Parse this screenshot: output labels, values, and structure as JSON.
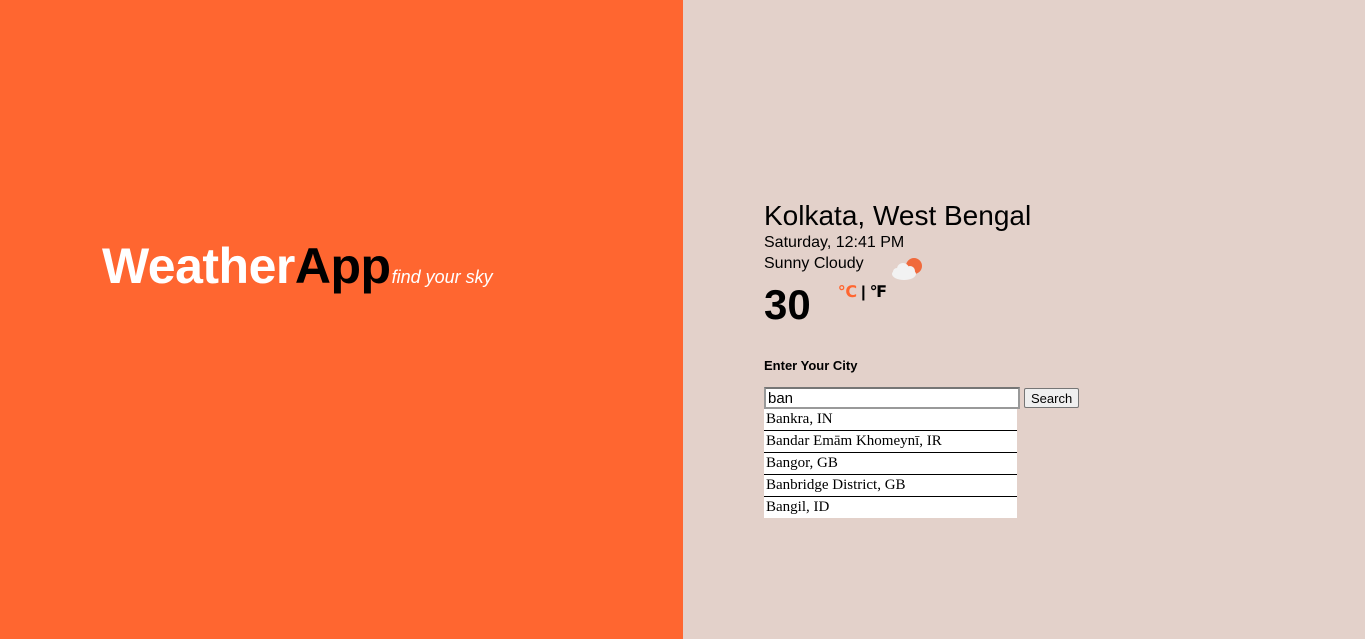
{
  "brand": {
    "name_part1": "Weather",
    "name_part2": "App",
    "tagline": "find your sky"
  },
  "weather": {
    "location": "Kolkata, West Bengal",
    "datetime": "Saturday, 12:41 PM",
    "condition": "Sunny Cloudy",
    "condition_icon": "partly-cloudy-icon",
    "temperature": "30",
    "unit_celsius": "℃",
    "unit_separator": "|",
    "unit_fahrenheit": "℉",
    "active_unit": "celsius"
  },
  "search": {
    "label": "Enter Your City",
    "value": "ban",
    "button_label": "Search",
    "suggestions": [
      "Bankra, IN",
      "Bandar Emām Khomeynī, IR",
      "Bangor, GB",
      "Banbridge District, GB",
      "Bangil, ID"
    ]
  },
  "colors": {
    "accent": "#ff6630",
    "right_background": "#e3d1ca",
    "cloud": "#f2f2f2",
    "sun": "#f06a3c"
  }
}
